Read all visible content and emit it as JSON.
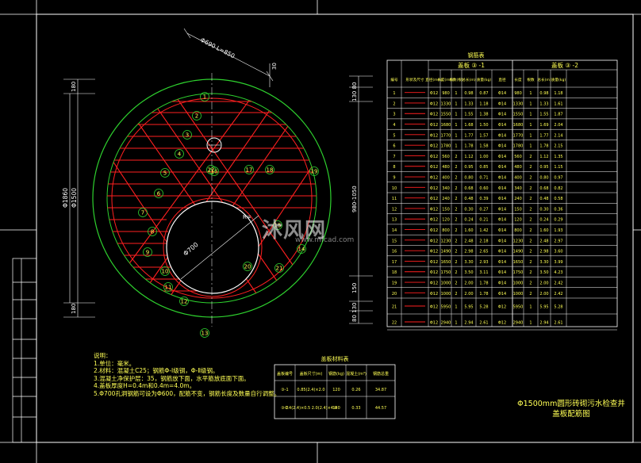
{
  "drawing": {
    "dim_top": "Φ690 L=850",
    "dim_30": "30",
    "dim_180_top": "180",
    "dim_1500": "Φ1500",
    "dim_1860": "Φ1860",
    "dim_180_bottom": "180",
    "dim_right_top": "130 80",
    "dim_right_span": "980-1050",
    "dim_right_150": "150",
    "dim_right_bottom": "80 130",
    "dim_hole": "Φ700",
    "dim_r": "R=",
    "bar_labels": [
      "1",
      "2",
      "3",
      "4",
      "5",
      "6",
      "7",
      "8",
      "9",
      "10",
      "11",
      "12",
      "13",
      "14",
      "15",
      "16",
      "17",
      "18",
      "19",
      "20",
      "21",
      "22"
    ]
  },
  "rebar_table": {
    "title": "钢筋表",
    "group1": "盖板 ③ -1",
    "group2": "盖板 ③ -2",
    "headers": [
      "编号",
      "形状及尺寸",
      "直径(mm)",
      "长度(mm)",
      "根数(根)",
      "总长(m)",
      "质量(kg)",
      "直径",
      "长度",
      "根数",
      "总长(m)",
      "质量(kg)"
    ],
    "rows": [
      [
        "1",
        "",
        "Φ12",
        "980",
        "1",
        "0.98",
        "0.87",
        "Φ14",
        "980",
        "1",
        "0.98",
        "1.18"
      ],
      [
        "2",
        "",
        "Φ12",
        "1330",
        "1",
        "1.33",
        "1.18",
        "Φ14",
        "1330",
        "1",
        "1.33",
        "1.61"
      ],
      [
        "3",
        "",
        "Φ12",
        "1550",
        "1",
        "1.55",
        "1.38",
        "Φ14",
        "1550",
        "1",
        "1.55",
        "1.87"
      ],
      [
        "4",
        "",
        "Φ12",
        "1680",
        "1",
        "1.68",
        "1.50",
        "Φ14",
        "1680",
        "1",
        "1.69",
        "2.04"
      ],
      [
        "5",
        "",
        "Φ12",
        "1770",
        "1",
        "1.77",
        "1.57",
        "Φ14",
        "1770",
        "1",
        "1.77",
        "2.14"
      ],
      [
        "6",
        "",
        "Φ12",
        "1780",
        "1",
        "1.78",
        "1.58",
        "Φ14",
        "1780",
        "1",
        "1.78",
        "2.15"
      ],
      [
        "7",
        "",
        "Φ12",
        "560",
        "2",
        "1.12",
        "1.00",
        "Φ14",
        "560",
        "2",
        "1.12",
        "1.35"
      ],
      [
        "8",
        "",
        "Φ12",
        "480",
        "2",
        "0.95",
        "0.85",
        "Φ14",
        "480",
        "2",
        "0.95",
        "1.15"
      ],
      [
        "9",
        "",
        "Φ12",
        "400",
        "2",
        "0.80",
        "0.71",
        "Φ14",
        "400",
        "2",
        "0.80",
        "0.97"
      ],
      [
        "10",
        "",
        "Φ12",
        "340",
        "2",
        "0.68",
        "0.60",
        "Φ14",
        "340",
        "2",
        "0.68",
        "0.82"
      ],
      [
        "11",
        "",
        "Φ12",
        "240",
        "2",
        "0.48",
        "0.39",
        "Φ14",
        "240",
        "2",
        "0.48",
        "0.58"
      ],
      [
        "12",
        "",
        "Φ12",
        "150",
        "2",
        "0.30",
        "0.27",
        "Φ14",
        "150",
        "2",
        "0.30",
        "0.36"
      ],
      [
        "13",
        "",
        "Φ12",
        "120",
        "2",
        "0.24",
        "0.21",
        "Φ14",
        "120",
        "2",
        "0.24",
        "0.29"
      ],
      [
        "14",
        "",
        "Φ12",
        "800",
        "2",
        "1.60",
        "1.42",
        "Φ14",
        "800",
        "2",
        "1.60",
        "1.93"
      ],
      [
        "15",
        "",
        "Φ12",
        "1230",
        "2",
        "2.48",
        "2.18",
        "Φ14",
        "1230",
        "2",
        "2.48",
        "2.97"
      ],
      [
        "16",
        "",
        "Φ12",
        "1490",
        "2",
        "2.98",
        "2.65",
        "Φ14",
        "1490",
        "2",
        "2.98",
        "3.60"
      ],
      [
        "17",
        "",
        "Φ12",
        "1650",
        "2",
        "3.30",
        "2.93",
        "Φ14",
        "1650",
        "2",
        "3.30",
        "3.99"
      ],
      [
        "18",
        "",
        "Φ12",
        "1750",
        "2",
        "3.50",
        "3.11",
        "Φ14",
        "1750",
        "2",
        "3.50",
        "4.23"
      ],
      [
        "19",
        "",
        "Φ12",
        "1000",
        "2",
        "2.00",
        "1.78",
        "Φ14",
        "1000",
        "2",
        "2.00",
        "2.42"
      ],
      [
        "20",
        "",
        "Φ12",
        "1000",
        "2",
        "2.00",
        "1.78",
        "Φ14",
        "1000",
        "2",
        "2.00",
        "2.42"
      ],
      [
        "21",
        "",
        "Φ12",
        "5950",
        "1",
        "5.95",
        "5.28",
        "Φ12",
        "5950",
        "1",
        "5.95",
        "5.28"
      ],
      [
        "22",
        "",
        "Φ12",
        "2940",
        "1",
        "2.94",
        "2.61",
        "Φ12",
        "2940",
        "1",
        "2.94",
        "2.61"
      ]
    ]
  },
  "material_table": {
    "title": "盖板材料表",
    "headers": [
      "盖板编号",
      "盖板尺寸(m)",
      "钢筋(kg)",
      "混凝土(m³)",
      "钢筋总重"
    ],
    "rows": [
      [
        "③-1",
        "0.85(2.4)×2.0",
        "120",
        "0.26",
        "34.87"
      ],
      [
        "③-2",
        "0.4(2.4)×0.5  2.0(2.4)×4.0",
        "140",
        "0.33",
        "44.57"
      ]
    ]
  },
  "notes": {
    "title": "说明：",
    "lines": [
      "1.单位：毫米。",
      "2.材料：混凝土C25；钢筋Φ-Ⅰ级钢，Φ-Ⅱ级钢。",
      "3.混凝土净保护层：35，钢筋放下面，水平筋放底面下面。",
      "4.盖板厚度H=0.4m和0.4m=4.0m。",
      "5.Φ700孔洞钢筋可设为Φ600，配筋不变，钢筋长度及数量自行调整。"
    ]
  },
  "title_block": {
    "line1": "Φ1500mm圆形砖砌污水检查井",
    "line2": "盖板配筋图"
  },
  "watermark": {
    "main": "沐风网",
    "sub": "www.mfcad.com"
  }
}
